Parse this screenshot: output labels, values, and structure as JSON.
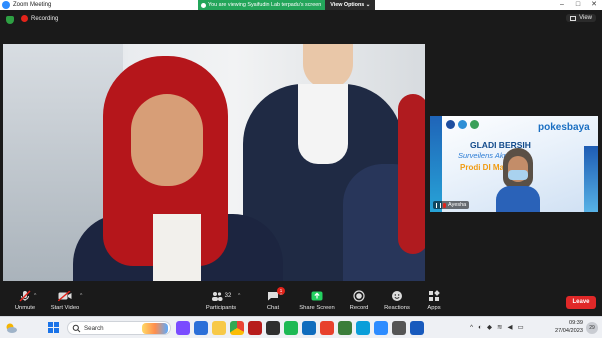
{
  "window": {
    "title": "Zoom Meeting",
    "controls": [
      "–",
      "□",
      "✕"
    ]
  },
  "share_banner": {
    "viewing_text": "You are viewing Syaifudin Lab terpadu's screen",
    "view_options_label": "View Options ⌄"
  },
  "topbar": {
    "recording_label": "Recording",
    "view_label": "View"
  },
  "side_video": {
    "brand": "pokesbaya",
    "headline_1": "GLADI BERSIH",
    "headline_2": "Surveilens   Akreditasi",
    "headline_3": "Prodi DI           Magetan",
    "participant_name": "Ayesha"
  },
  "toolbar": {
    "unmute_label": "Unmute",
    "stop_video_label": "Start Video",
    "participants_label": "Participants",
    "participants_count": "32",
    "chat_label": "Chat",
    "chat_badge": "1",
    "share_label": "Share Screen",
    "record_label": "Record",
    "reactions_label": "Reactions",
    "apps_label": "Apps",
    "leave_label": "Leave",
    "colors": {
      "share": "#23d160",
      "leave": "#e02828"
    }
  },
  "taskbar": {
    "search_placeholder": "Search",
    "time": "09:39",
    "date": "27/04/2023",
    "tray_avatar": "29",
    "icons": [
      "weather-icon",
      "start-icon",
      "search-icon",
      "file-explorer-icon",
      "zoom-icon",
      "chrome-icon",
      "store-icon",
      "mail-icon",
      "spotify-icon",
      "photos-icon",
      "edge-icon",
      "word-icon"
    ]
  }
}
